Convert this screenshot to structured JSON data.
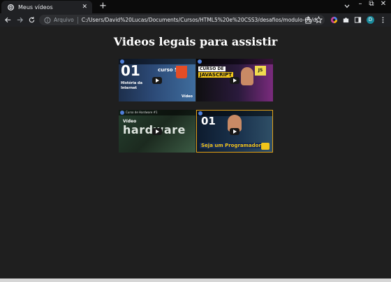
{
  "browser": {
    "tab_title": "Meus vídeos",
    "new_tab": "+",
    "scheme_label": "Arquivo",
    "url": "C:/Users/David%20Lucas/Documents/Cursos/HTML5%20e%20CSS3/desafios/modulo-01/d...",
    "profile_initial": "D",
    "window_controls": [
      "–",
      "⧉",
      "✕"
    ]
  },
  "page": {
    "heading": "Videos legais para assistir",
    "videos": [
      {
        "label": "01",
        "caption": "História da Internet",
        "badge": "curso 5",
        "corner": "Vídeo"
      },
      {
        "label": "CURSO DE",
        "caption": "JAVASCRIPT",
        "badge": "JS"
      },
      {
        "label": "Vídeo",
        "caption": "Hardware",
        "bar": "Curso de Hardware #1"
      },
      {
        "label": "01",
        "caption": "Seja um Programador"
      }
    ]
  },
  "colors": {
    "page_bg": "#1f1f1f",
    "accent_orange": "#e0a017"
  }
}
